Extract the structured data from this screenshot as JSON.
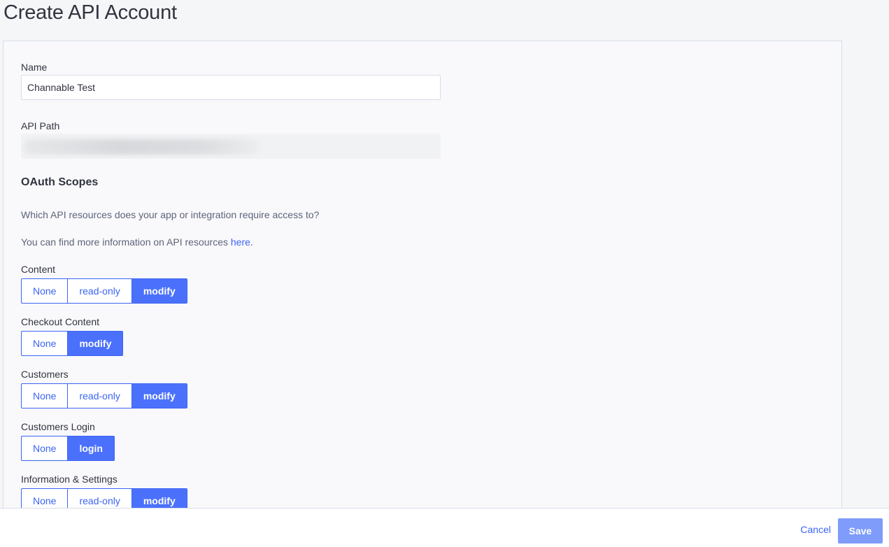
{
  "page": {
    "title": "Create API Account"
  },
  "form": {
    "name_label": "Name",
    "name_value": "Channable Test",
    "api_path_label": "API Path"
  },
  "oauth": {
    "heading": "OAuth Scopes",
    "description": "Which API resources does your app or integration require access to?",
    "info_prefix": "You can find more information on API resources ",
    "info_link": "here",
    "info_suffix": ".",
    "scopes": [
      {
        "label": "Content",
        "options": [
          "None",
          "read-only",
          "modify"
        ],
        "selected": "modify"
      },
      {
        "label": "Checkout Content",
        "options": [
          "None",
          "modify"
        ],
        "selected": "modify"
      },
      {
        "label": "Customers",
        "options": [
          "None",
          "read-only",
          "modify"
        ],
        "selected": "modify"
      },
      {
        "label": "Customers Login",
        "options": [
          "None",
          "login"
        ],
        "selected": "login"
      },
      {
        "label": "Information & Settings",
        "options": [
          "None",
          "read-only",
          "modify"
        ],
        "selected": "modify"
      }
    ]
  },
  "footer": {
    "cancel_label": "Cancel",
    "save_label": "Save"
  },
  "colors": {
    "accent": "#3c64f4",
    "active_fill": "#4b71fc",
    "save_disabled": "#7f9cfb"
  }
}
